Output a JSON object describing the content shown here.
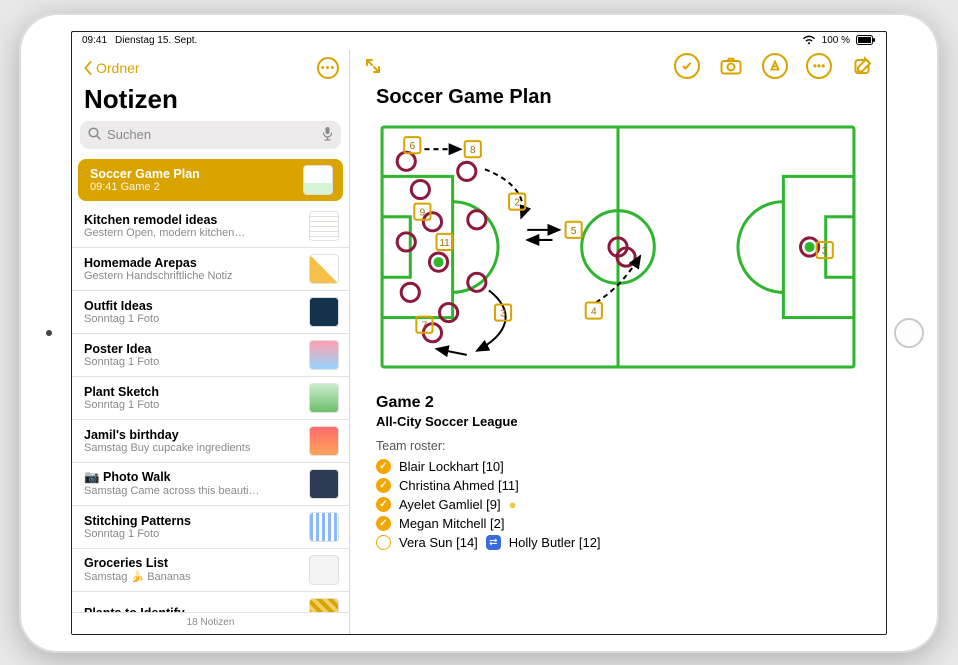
{
  "statusbar": {
    "time": "09:41",
    "date": "Dienstag 15. Sept.",
    "battery_text": "100 %"
  },
  "sidebar": {
    "back_label": "Ordner",
    "title": "Notizen",
    "search_placeholder": "Suchen",
    "footer": "18 Notizen",
    "notes": [
      {
        "title": "Soccer Game Plan",
        "time": "09:41",
        "preview": "Game 2",
        "thumb": "th-field",
        "selected": true
      },
      {
        "title": "Kitchen remodel ideas",
        "time": "Gestern",
        "preview": "Open, modern kitchen…",
        "thumb": "th-kitchen"
      },
      {
        "title": "Homemade Arepas",
        "time": "Gestern",
        "preview": "Handschriftliche Notiz",
        "thumb": "th-arepas"
      },
      {
        "title": "Outfit Ideas",
        "time": "Sonntag",
        "preview": "1 Foto",
        "thumb": "th-outfit"
      },
      {
        "title": "Poster Idea",
        "time": "Sonntag",
        "preview": "1 Foto",
        "thumb": "th-poster"
      },
      {
        "title": "Plant Sketch",
        "time": "Sonntag",
        "preview": "1 Foto",
        "thumb": "th-plant"
      },
      {
        "title": "Jamil's birthday",
        "time": "Samstag",
        "preview": "Buy cupcake ingredients",
        "thumb": "th-birthday"
      },
      {
        "title": "📷  Photo Walk",
        "time": "Samstag",
        "preview": "Came across this beauti…",
        "thumb": "th-photo"
      },
      {
        "title": "Stitching Patterns",
        "time": "Sonntag",
        "preview": "1 Foto",
        "thumb": "th-stitch"
      },
      {
        "title": "Groceries List",
        "time": "Samstag",
        "preview": "🍌 Bananas",
        "thumb": "th-grocery"
      },
      {
        "title": "Plants to Identify",
        "time": "",
        "preview": "",
        "thumb": "th-plantsid"
      }
    ]
  },
  "note": {
    "title": "Soccer Game Plan",
    "subtitle": "Game 2",
    "league": "All-City Soccer League",
    "roster_label": "Team roster:",
    "roster": [
      {
        "name": "Blair Lockhart [10]",
        "checked": true,
        "extra": ""
      },
      {
        "name": "Christina Ahmed [11]",
        "checked": true,
        "extra": ""
      },
      {
        "name": "Ayelet Gamliel [9]",
        "checked": true,
        "extra": "dot"
      },
      {
        "name": "Megan Mitchell [2]",
        "checked": true,
        "extra": ""
      },
      {
        "name": "Vera Sun [14]",
        "checked": false,
        "extra": "swap",
        "swap_name": "Holly Butler [12]"
      }
    ]
  },
  "colors": {
    "accent": "#d9a300",
    "field": "#2fb52f",
    "player_ring": "#8d1a3d",
    "marker": "#d9a300"
  }
}
